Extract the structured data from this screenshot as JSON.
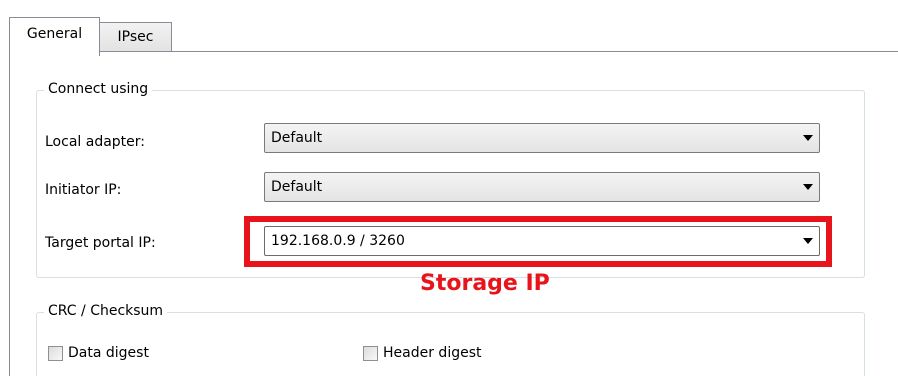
{
  "tabs": [
    {
      "label": "General",
      "selected": true
    },
    {
      "label": "IPsec",
      "selected": false
    }
  ],
  "connect_group": {
    "title": "Connect using",
    "fields": [
      {
        "label": "Local adapter:",
        "value": "Default"
      },
      {
        "label": "Initiator IP:",
        "value": "Default"
      },
      {
        "label": "Target portal IP:",
        "value": "192.168.0.9 / 3260"
      }
    ]
  },
  "annotation": {
    "text": "Storage IP",
    "color": "#e8141b"
  },
  "crc_group": {
    "title": "CRC / Checksum",
    "checkboxes": [
      {
        "label": "Data digest",
        "checked": false
      },
      {
        "label": "Header digest",
        "checked": false
      }
    ]
  },
  "icons": {
    "dropdown": "chevron-down-icon"
  }
}
